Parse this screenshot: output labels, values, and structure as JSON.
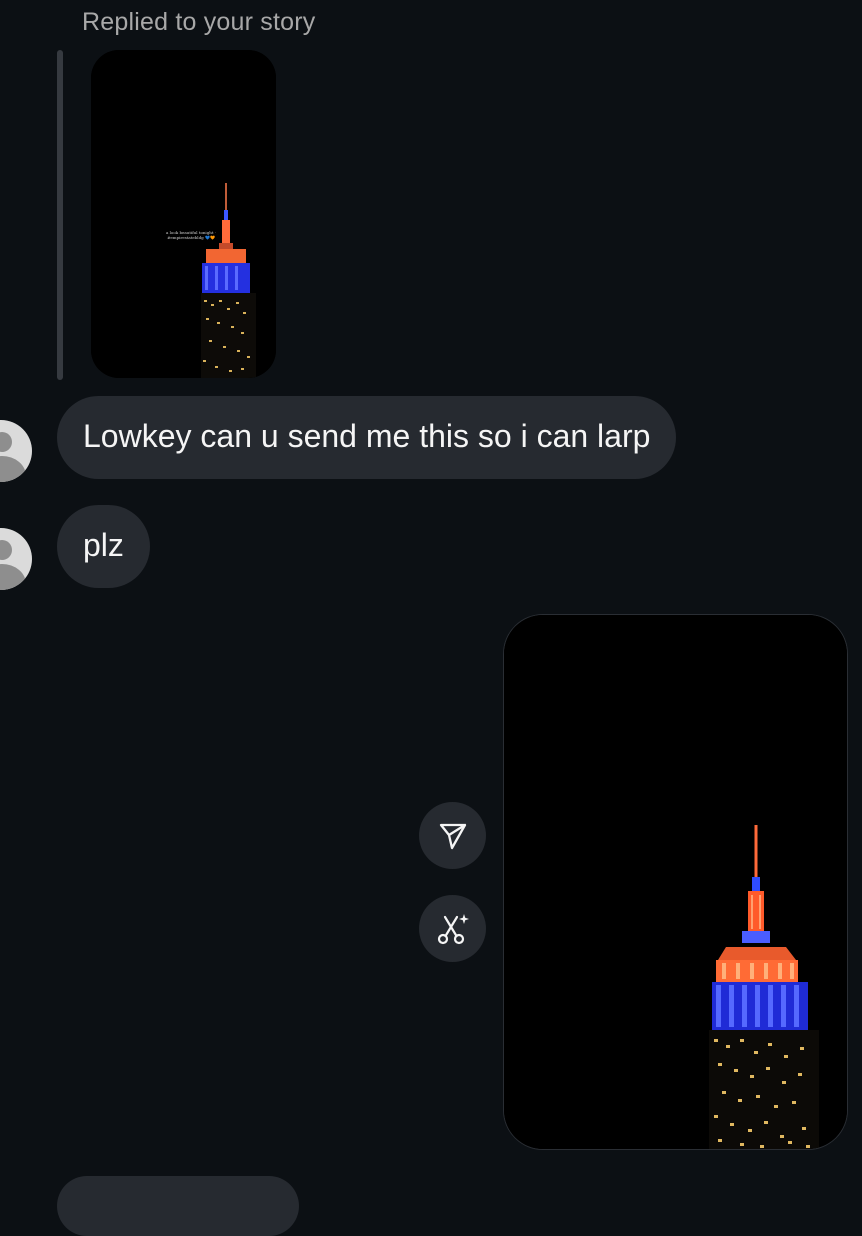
{
  "reply_context": {
    "label": "Replied to your story",
    "story_caption": "a look beautiful tonight · #empirestatebldg 💙🧡"
  },
  "messages": [
    {
      "from": "other",
      "text": "Lowkey can u send me this so i can larp"
    },
    {
      "from": "other",
      "text": "plz"
    },
    {
      "from": "other",
      "text": ""
    }
  ],
  "sent_image": {
    "description_icon": "building-photo"
  },
  "actions": {
    "share_icon": "paper-plane-icon",
    "ai_edit_icon": "scissors-sparkle-icon"
  },
  "colors": {
    "background": "#0c1014",
    "bubble": "#262a30",
    "label": "#a8a8a8",
    "blue_light": "#2b3bd8",
    "orange_light": "#e8552a"
  }
}
